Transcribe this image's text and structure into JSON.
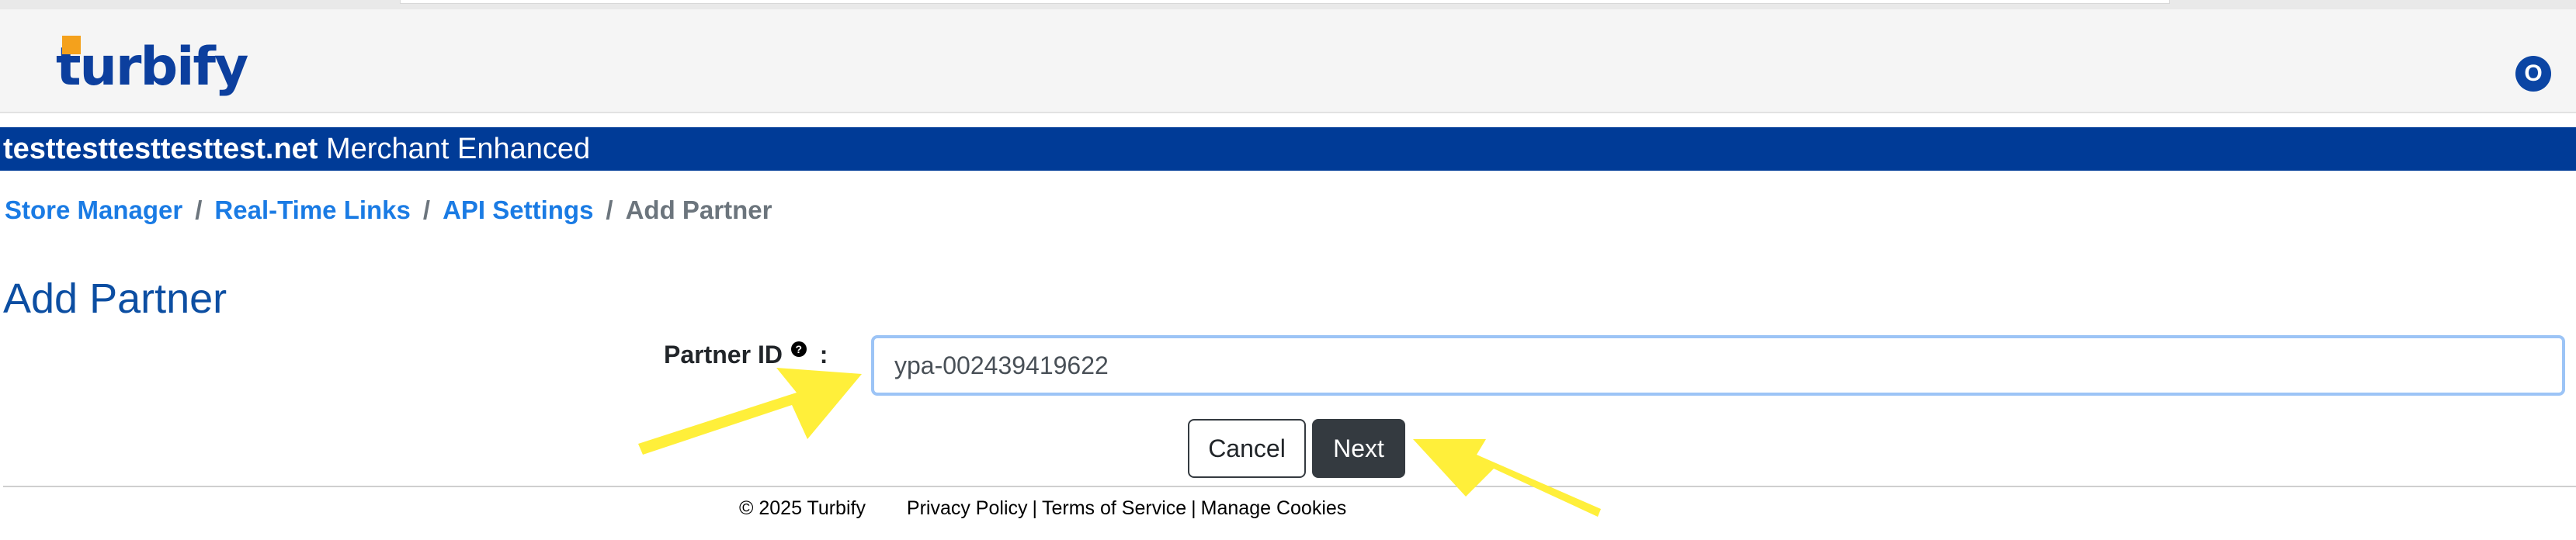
{
  "header": {
    "logo_text": "turbify",
    "avatar_initial": "O",
    "brand_color": "#003b97",
    "logo_accent_color": "#f4a11c"
  },
  "store_bar": {
    "domain": "testtesttesttesttest.net",
    "plan": "Merchant Enhanced"
  },
  "breadcrumb": {
    "items": [
      "Store Manager",
      "Real-Time Links",
      "API Settings"
    ],
    "separator": "/",
    "current": "Add Partner"
  },
  "page": {
    "title": "Add Partner"
  },
  "form": {
    "partner_id_label": "Partner ID",
    "help_icon_glyph": "?",
    "label_colon": ":",
    "partner_id_value": "ypa-002439419622",
    "cancel_label": "Cancel",
    "next_label": "Next"
  },
  "footer": {
    "copyright": "© 2025 Turbify",
    "links": [
      "Privacy Policy",
      "Terms of Service",
      "Manage Cookies"
    ],
    "separator": "|"
  },
  "annotations": {
    "arrow_color": "#ffef3a",
    "arrows": [
      "arrow-pointing-to-partner-id-input",
      "arrow-pointing-to-next-button"
    ]
  }
}
